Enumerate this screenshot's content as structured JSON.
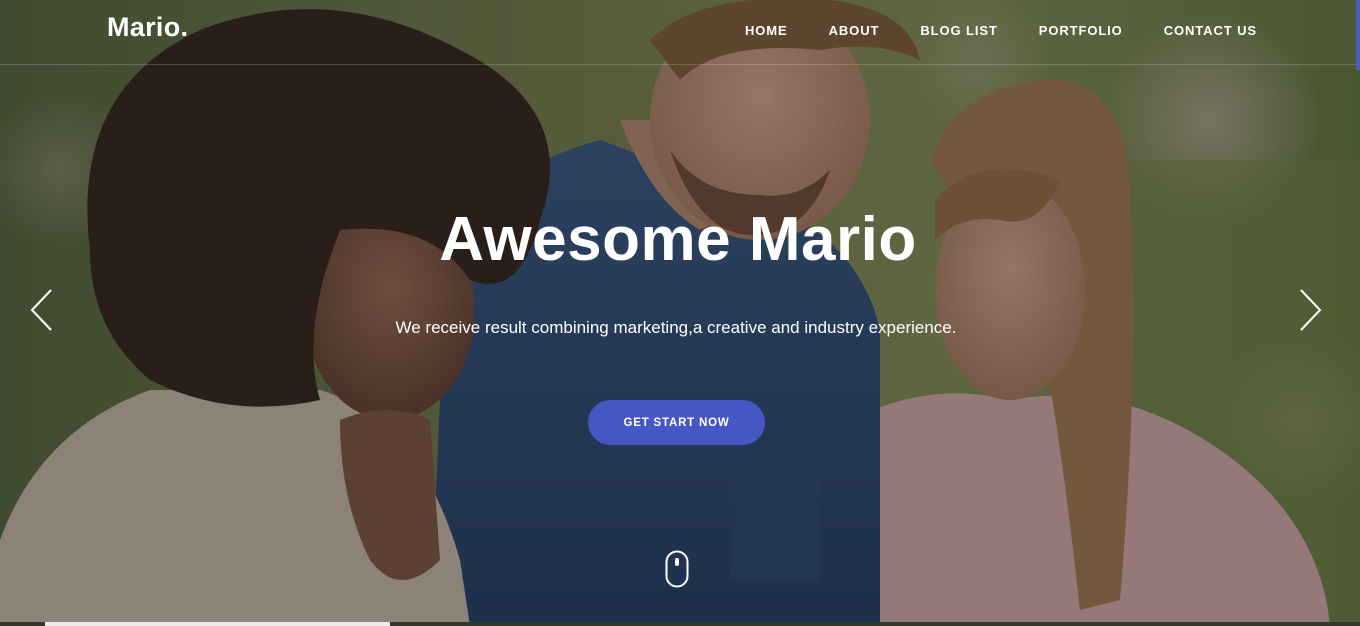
{
  "brand": {
    "logo": "Mario."
  },
  "nav": {
    "items": [
      "HOME",
      "ABOUT",
      "BLOG LIST",
      "PORTFOLIO",
      "CONTACT US"
    ]
  },
  "hero": {
    "title": "Awesome Mario",
    "subtitle": "We receive result combining marketing,a creative and industry experience.",
    "cta_label": "GET START NOW"
  },
  "icons": {
    "prev": "chevron-left-icon",
    "next": "chevron-right-icon",
    "scroll": "mouse-scroll-icon"
  },
  "colors": {
    "accent": "#4557c2",
    "text": "#ffffff",
    "overlay": "#0f1218"
  }
}
